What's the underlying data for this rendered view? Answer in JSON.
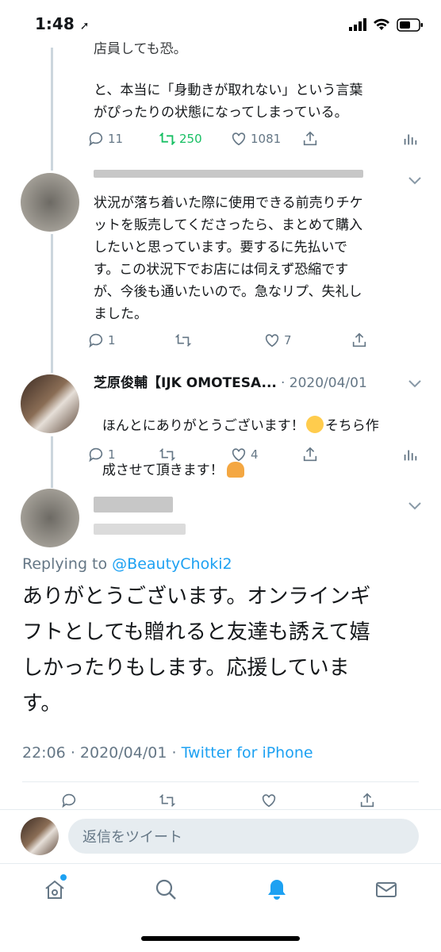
{
  "status": {
    "time": "1:48"
  },
  "tweet1": {
    "text_partial": "店員しても恐。",
    "text": "と、本当に「身動きが取れない」という言葉\nがぴったりの状態になってしまっている。",
    "reply_count": "11",
    "retweet_count": "250",
    "like_count": "1081"
  },
  "tweet2": {
    "text": "状況が落ち着いた際に使用できる前売りチケ\nットを販売してくださったら、まとめて購入\nしたいと思っています。要するに先払いで\nす。この状況下でお店には伺えず恐縮です\nが、今後も通いたいので。急なリプ、失礼し\nました。",
    "reply_count": "1",
    "like_count": "7"
  },
  "tweet3": {
    "name": "芝原俊輔【IJK OMOTESA...",
    "date": "2020/04/01",
    "text_line1": "ほんとにありがとうございます！",
    "text_line1b": "そちら作",
    "text_line2": "成させて頂きます！",
    "reply_count": "1",
    "like_count": "4"
  },
  "main_tweet": {
    "replying_prefix": "Replying to",
    "replying_handle": "@BeautyChoki2",
    "text": "ありがとうございます。オンラインギ\nフトとしても贈れると友達も誘えて嬉\nしかったりもします。応援していま\nす。",
    "time": "22:06",
    "date": "2020/04/01",
    "source": "Twitter for iPhone"
  },
  "reply_bar": {
    "placeholder": "返信をツイート"
  },
  "colors": {
    "accent": "#1da1f2",
    "retweet": "#17bf63",
    "muted": "#657786"
  },
  "tabs": [
    "home-icon",
    "search-icon",
    "notifications-icon",
    "messages-icon"
  ]
}
